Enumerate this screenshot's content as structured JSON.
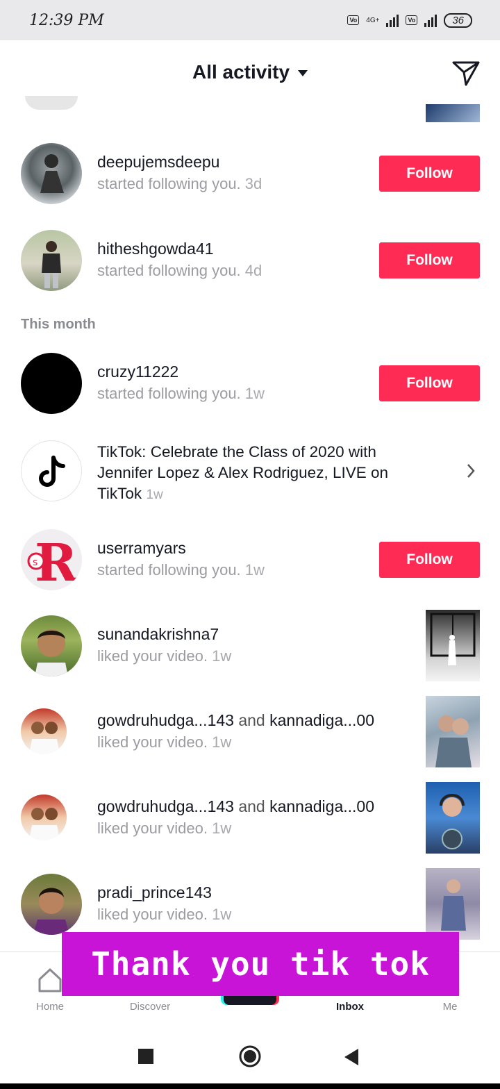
{
  "status_bar": {
    "time": "12:39 PM",
    "network1": "4G+",
    "volte_label": "Vo LTE",
    "battery": "36"
  },
  "header": {
    "title": "All activity"
  },
  "colors": {
    "follow_button": "#fe2c55",
    "caption_bg": "#c714d6"
  },
  "notifications": [
    {
      "username": "deepujemsdeepu",
      "action": "started following you.",
      "time": "3d",
      "button": "Follow"
    },
    {
      "username": "hitheshgowda41",
      "action": "started following you.",
      "time": "4d",
      "button": "Follow"
    }
  ],
  "section_label": "This month",
  "notifications_month": [
    {
      "username": "cruzy11222",
      "action": "started following you.",
      "time": "1w",
      "button": "Follow"
    },
    {
      "username": "TikTok:",
      "action": "Celebrate the Class of 2020 with Jennifer Lopez & Alex Rodriguez, LIVE on TikTok",
      "time": "1w"
    },
    {
      "username": "userramyars",
      "action": "started following you.",
      "time": "1w",
      "button": "Follow"
    },
    {
      "username": "sunandakrishna7",
      "action": "liked your video.",
      "time": "1w"
    },
    {
      "username": "gowdruhudga...143",
      "conj": "and",
      "username2": "kannadiga...00",
      "action": "liked your video.",
      "time": "1w"
    },
    {
      "username": "gowdruhudga...143",
      "conj": "and",
      "username2": "kannadiga...00",
      "action": "liked your video.",
      "time": "1w"
    },
    {
      "username": "pradi_prince143",
      "action": "liked your video.",
      "time": "1w"
    }
  ],
  "tabs": {
    "home": "Home",
    "discover": "Discover",
    "inbox": "Inbox",
    "me": "Me"
  },
  "caption": "Thank you tik tok"
}
